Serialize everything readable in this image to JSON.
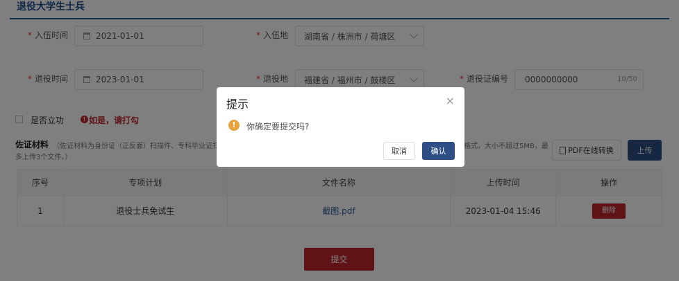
{
  "section": {
    "title": "退役大学生士兵"
  },
  "form": {
    "enlist_date": {
      "label": "入伍时间",
      "value": "2021-01-01"
    },
    "enlist_place": {
      "label": "入伍地",
      "value": "湖南省 / 株洲市 / 荷塘区"
    },
    "discharge_date": {
      "label": "退役时间",
      "value": "2023-01-01"
    },
    "discharge_place": {
      "label": "退役地",
      "value": "福建省 / 福州市 / 鼓楼区"
    },
    "cert_no": {
      "label": "退役证编号",
      "value": "0000000000",
      "counter": "10/50"
    },
    "merit": {
      "label": "是否立功",
      "hint": "如是，请打勾"
    }
  },
  "materials": {
    "title": "佐证材料",
    "desc_line1": "（佐证材料为身份证（正反面）扫描件、专科毕业证扫",
    "desc_right": "格式，大小不超过5MB，最",
    "desc_line2": "多上传3个文件。）",
    "pdf_button": "PDF在线转换",
    "upload_button": "上传"
  },
  "table": {
    "columns": [
      "序号",
      "专项计划",
      "文件名称",
      "上传时间",
      "操作"
    ],
    "rows": [
      {
        "index": "1",
        "plan": "退役士兵免试生",
        "file": "截图.pdf",
        "time": "2023-01-04 15:46",
        "action": "删除"
      }
    ]
  },
  "submit_button": "提交",
  "dialog": {
    "title": "提示",
    "close": "×",
    "message": "你确定要提交吗?",
    "cancel": "取消",
    "confirm": "确认"
  },
  "colors": {
    "primary": "#2d4f85",
    "danger": "#c0272d",
    "warning": "#e6a23c"
  }
}
